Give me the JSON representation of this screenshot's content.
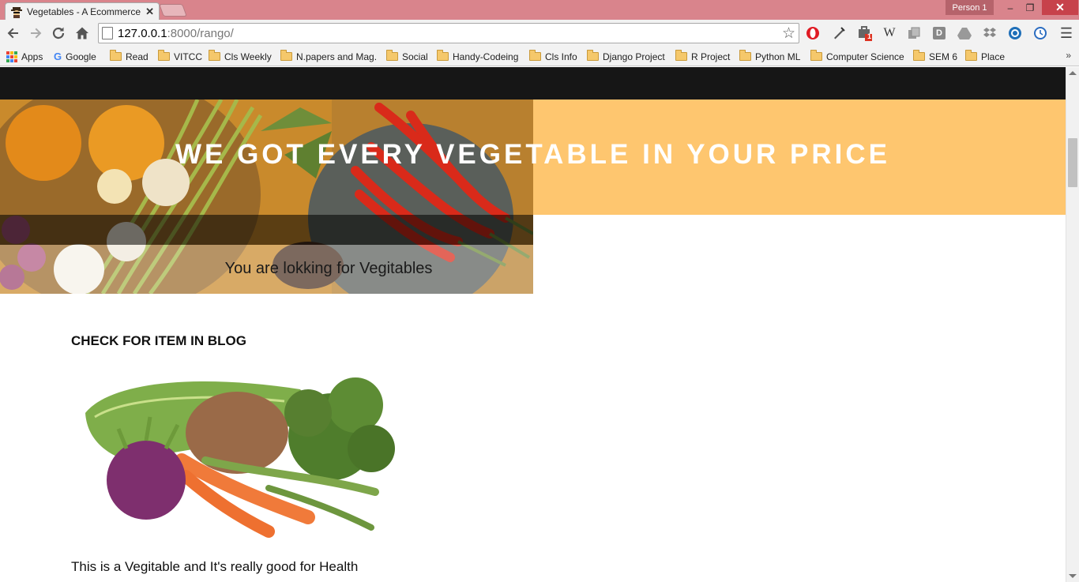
{
  "browser": {
    "tab_title": "Vegetables - A Ecommerce",
    "tab_close": "✕",
    "profile_name": "Person 1",
    "window_minimize": "–",
    "window_maximize": "❐",
    "window_close": "✕",
    "url_host": "127.0.0.1",
    "url_path": ":8000/rango/",
    "bookmarks": [
      {
        "label": "Apps"
      },
      {
        "label": "Google"
      },
      {
        "label": "Read"
      },
      {
        "label": "VITCC"
      },
      {
        "label": "Cls Weekly"
      },
      {
        "label": "N.papers and Mag."
      },
      {
        "label": "Social"
      },
      {
        "label": "Handy-Codeing"
      },
      {
        "label": "Cls Info"
      },
      {
        "label": "Django Project"
      },
      {
        "label": "R Project"
      },
      {
        "label": "Python ML"
      },
      {
        "label": "Computer Science"
      },
      {
        "label": "SEM 6"
      },
      {
        "label": "Place"
      }
    ],
    "bookmarks_overflow": "»",
    "extension_badge": "1",
    "ext_w": "W",
    "ext_d": "D"
  },
  "page": {
    "hero_title": "WE GOT EVERY VEGETABLE IN YOUR PRICE",
    "hero_subtitle": "You are lokking for Vegitables",
    "section_title": "CHECK FOR ITEM IN BLOG",
    "item_description": "This is a Vegitable and It's really good for Health"
  },
  "colors": {
    "tabstrip": "#d9848c",
    "topbar": "#161616",
    "hero_accent": "#fec66f"
  }
}
